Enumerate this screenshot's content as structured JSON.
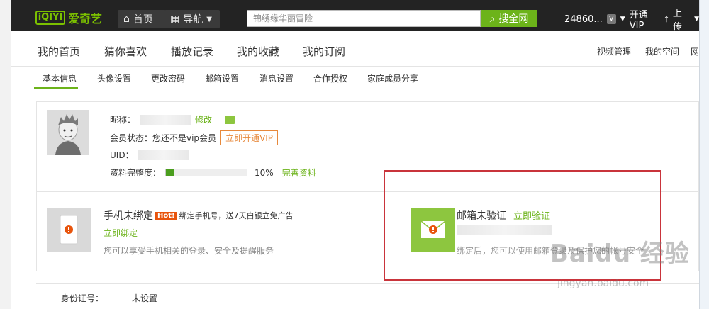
{
  "topbar": {
    "logo_mark": "iQIYI",
    "logo_text": "爱奇艺",
    "home_label": "首页",
    "nav_label": "导航",
    "search_placeholder": "锦绣缘华丽冒险",
    "search_button": "搜全网",
    "username": "24860...",
    "vip_label": "开通VIP",
    "upload_label": "上传"
  },
  "secnav": {
    "items": [
      "我的首页",
      "猜你喜欢",
      "播放记录",
      "我的收藏",
      "我的订阅"
    ],
    "right_items": [
      "视频管理",
      "我的空间",
      "网"
    ]
  },
  "tabs": [
    "基本信息",
    "头像设置",
    "更改密码",
    "邮箱设置",
    "消息设置",
    "合作授权",
    "家庭成员分享"
  ],
  "profile": {
    "nickname_label": "昵称：",
    "edit_link": "修改",
    "member_status_label": "会员状态：您还不是vip会员",
    "vip_button": "立即开通VIP",
    "uid_label": "UID：",
    "completeness_label": "资料完整度：",
    "completeness_value": "10%",
    "completeness_fraction": 0.1,
    "complete_link": "完善资料"
  },
  "phone_card": {
    "title": "手机未绑定",
    "hot_badge": "Hot!",
    "promo": "绑定手机号，送7天白银立免广告",
    "link": "立即绑定",
    "desc": "您可以享受手机相关的登录、安全及提醒服务"
  },
  "mail_card": {
    "title": "邮箱未验证",
    "link": "立即验证",
    "desc": "绑定后，您可以使用邮箱登录及保护您的帐号安全"
  },
  "bottom": {
    "idcard_label": "身份证号：",
    "idcard_value": "未设置"
  },
  "watermark": {
    "main": "Baidu 经验",
    "sub": "jingyan.baidu.com"
  },
  "colors": {
    "brand_green": "#6cb31a",
    "topbar": "#232323",
    "annotation_red": "#c9343b",
    "vip_orange": "#e7893c"
  }
}
